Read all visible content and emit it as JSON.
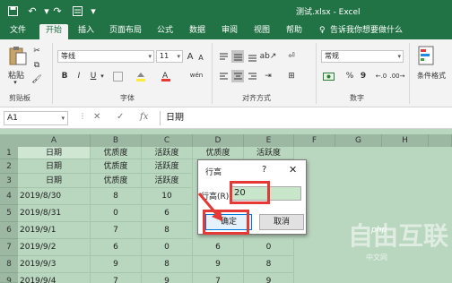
{
  "titlebar": {
    "title": "测试.xlsx  -  Excel",
    "save_icon": "save-icon",
    "undo_icon": "undo-icon",
    "redo_icon": "redo-icon",
    "form_icon": "form-icon"
  },
  "tabs": [
    "文件",
    "开始",
    "插入",
    "页面布局",
    "公式",
    "数据",
    "审阅",
    "视图",
    "帮助",
    "告诉我你想要做什么"
  ],
  "ribbon": {
    "paste_label": "粘贴",
    "clipboard_label": "剪贴板",
    "font_name": "等线",
    "font_size": "11",
    "grow_font": "A",
    "shrink_font": "A",
    "bold": "B",
    "italic": "I",
    "underline": "U",
    "font_group": "字体",
    "wen": "wén",
    "align_group": "对齐方式",
    "number_format": "常规",
    "percent": "%",
    "comma": "9",
    "number_group": "数字",
    "cond_format": "条件格式"
  },
  "formula_bar": {
    "name_box": "A1",
    "fx": "fx",
    "cancel": "✕",
    "enter": "✓",
    "value": "日期"
  },
  "columns": [
    "A",
    "B",
    "C",
    "D",
    "E",
    "F",
    "G",
    "H"
  ],
  "rows": [
    "1",
    "2",
    "3",
    "4",
    "5",
    "6",
    "7",
    "8",
    "9"
  ],
  "cells": [
    [
      "日期",
      "优质度",
      "活跃度",
      "优质度",
      "活跃度"
    ],
    [
      "日期",
      "优质度",
      "活跃度",
      "",
      ""
    ],
    [
      "日期",
      "优质度",
      "活跃度",
      "",
      ""
    ],
    [
      "2019/8/30",
      "8",
      "10",
      "",
      ""
    ],
    [
      "2019/8/31",
      "0",
      "6",
      "",
      ""
    ],
    [
      "2019/9/1",
      "7",
      "8",
      "",
      ""
    ],
    [
      "2019/9/2",
      "6",
      "0",
      "6",
      "0"
    ],
    [
      "2019/9/3",
      "9",
      "8",
      "9",
      "8"
    ],
    [
      "2019/9/4",
      "7",
      "9",
      "7",
      "9"
    ]
  ],
  "dialog": {
    "title": "行高",
    "help": "?",
    "close": "✕",
    "label": "行高(R):",
    "value": "20",
    "ok": "确定",
    "cancel": "取消"
  },
  "watermark": {
    "main": "自由互联",
    "php": "php",
    "sub": "中文网"
  },
  "colors": {
    "excel_green": "#217346",
    "sheet_bg": "#b9d6bf",
    "highlight": "#e53935"
  }
}
